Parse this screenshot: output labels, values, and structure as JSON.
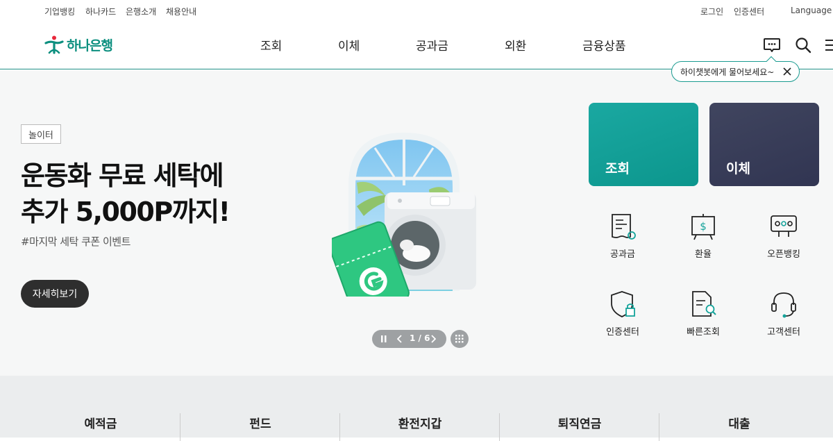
{
  "utility": {
    "left": [
      "기업뱅킹",
      "하나카드",
      "은행소개",
      "채용안내"
    ],
    "login": "로그인",
    "cert_center": "인증센터",
    "language": "Language"
  },
  "header": {
    "logo_text": "하나은행",
    "nav": [
      "조회",
      "이체",
      "공과금",
      "외환",
      "금융상품"
    ]
  },
  "tooltip": {
    "text": "하이챗봇에게 물어보세요~"
  },
  "hero": {
    "badge": "놀이터",
    "title_line1": "운동화 무료 세탁에",
    "title_line2": "추가 5,000P까지!",
    "subtitle": "#마지막 세탁 쿠폰 이벤트",
    "cta": "자세히보기",
    "pager_text": "1 / 6"
  },
  "quick": {
    "card1": "조회",
    "card2": "이체",
    "menu": [
      "공과금",
      "환율",
      "오픈뱅킹",
      "인증센터",
      "빠른조회",
      "고객센터"
    ]
  },
  "products": [
    "예적금",
    "펀드",
    "환전지갑",
    "퇴직연금",
    "대출"
  ],
  "colors": {
    "brand": "#0c8f7f",
    "teal_card": "#14a39a",
    "navy_card": "#363b5c",
    "dark_button": "#2e2e2e"
  }
}
